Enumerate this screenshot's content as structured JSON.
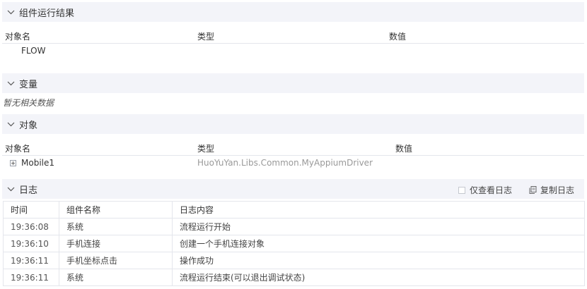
{
  "results": {
    "title": "组件运行结果",
    "columns": [
      "对象名",
      "类型",
      "数值"
    ],
    "rows": [
      {
        "name": "FLOW",
        "type": "",
        "value": ""
      }
    ]
  },
  "variables": {
    "title": "变量",
    "empty_text": "暂无相关数据"
  },
  "objects": {
    "title": "对象",
    "columns": [
      "对象名",
      "类型",
      "数值"
    ],
    "rows": [
      {
        "name": "Mobile1",
        "type": "HuoYuYan.Libs.Common.MyAppiumDriver",
        "value": ""
      }
    ]
  },
  "log": {
    "title": "日志",
    "only_view_log_label": "仅查看日志",
    "copy_log_label": "复制日志",
    "columns": [
      "时间",
      "组件名称",
      "日志内容"
    ],
    "rows": [
      {
        "time": "19:36:08",
        "component": "系统",
        "content": "流程运行开始"
      },
      {
        "time": "19:36:10",
        "component": "手机连接",
        "content": "创建一个手机连接对象"
      },
      {
        "time": "19:36:11",
        "component": "手机坐标点击",
        "content": "操作成功"
      },
      {
        "time": "19:36:11",
        "component": "系统",
        "content": "流程运行结束(可以退出调试状态)"
      }
    ]
  }
}
